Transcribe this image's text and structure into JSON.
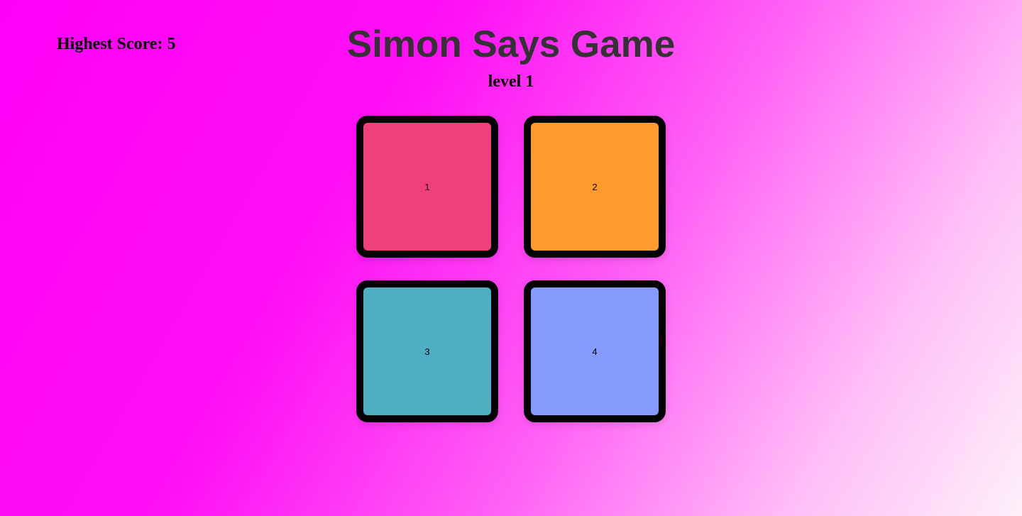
{
  "header": {
    "highest_score_label": "Highest Score: 5",
    "title": "Simon Says Game",
    "level": "level 1"
  },
  "buttons": [
    {
      "label": "1",
      "color": "#ef4079"
    },
    {
      "label": "2",
      "color": "#ff9a2e"
    },
    {
      "label": "3",
      "color": "#4faec4"
    },
    {
      "label": "4",
      "color": "#8699fd"
    }
  ]
}
